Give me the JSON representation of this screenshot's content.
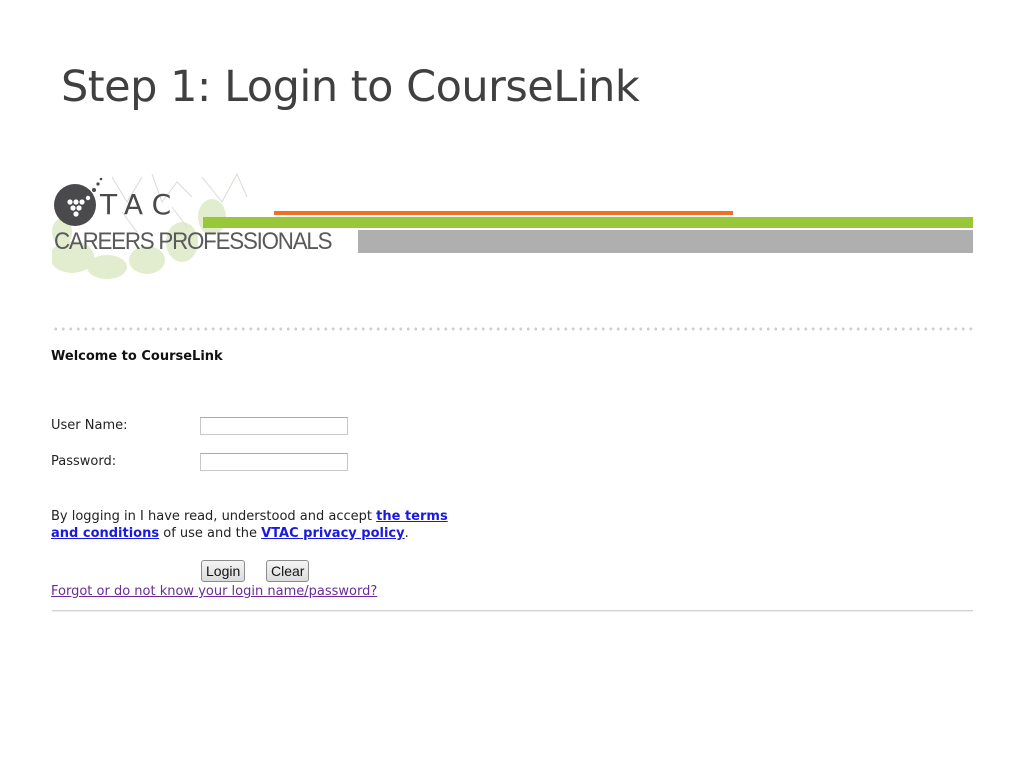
{
  "slide": {
    "title": "Step 1: Login to CourseLink"
  },
  "banner": {
    "logo_text": "TAC",
    "logo_initial": "V",
    "tagline": "CAREERS PROFESSIONALS",
    "colors": {
      "orange": "#f07022",
      "green": "#98c83a",
      "gray": "#afafaf",
      "logo": "#4a4a4c"
    }
  },
  "login": {
    "heading": "Welcome to CourseLink",
    "username_label": "User Name:",
    "username_value": "",
    "password_label": "Password:",
    "password_value": "",
    "terms_prefix": "By logging in I have read, understood and accept ",
    "terms_link": "the terms and conditions",
    "terms_middle": " of use and the ",
    "privacy_link": "VTAC privacy policy",
    "terms_suffix": ".",
    "login_button": "Login",
    "clear_button": "Clear",
    "forgot_link": "Forgot or do not know your login name/password?",
    "link_color": "#1a1adf",
    "visited_link_color": "#6a2b9a"
  }
}
